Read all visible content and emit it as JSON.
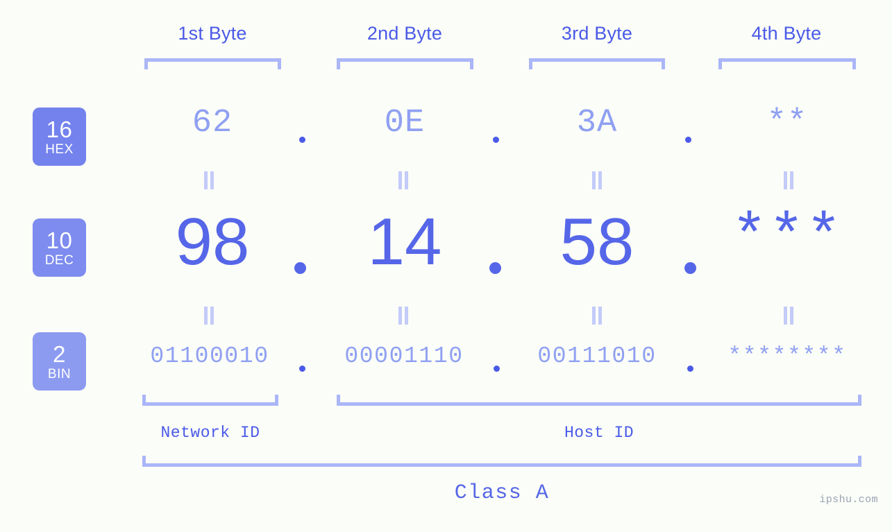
{
  "meta": {
    "background_color": "#FBFDF8",
    "accent_color": "#5566E8",
    "accent_light_color": "#8FA0F2",
    "bracket_color": "#AAB6F7",
    "watermark": "ipshu.com"
  },
  "byte_headers": [
    {
      "label": "1st Byte"
    },
    {
      "label": "2nd Byte"
    },
    {
      "label": "3rd Byte"
    },
    {
      "label": "4th Byte"
    }
  ],
  "bases": [
    {
      "num": "16",
      "name": "HEX",
      "color": "#7382EC"
    },
    {
      "num": "10",
      "name": "DEC",
      "color": "#7D8CEE"
    },
    {
      "num": "2",
      "name": "BIN",
      "color": "#8C9BF0"
    }
  ],
  "rows": {
    "hex": {
      "values": [
        "62",
        "0E",
        "3A",
        "**"
      ],
      "separator": "."
    },
    "dec": {
      "values": [
        "98",
        "14",
        "58",
        "***"
      ],
      "separator": "."
    },
    "bin": {
      "values": [
        "01100010",
        "00001110",
        "00111010",
        "********"
      ],
      "separator": "."
    }
  },
  "id_labels": {
    "network": "Network ID",
    "host": "Host ID"
  },
  "class_label": "Class A",
  "chart_data": {
    "type": "table",
    "title": "Class A",
    "categories": [
      "1st Byte",
      "2nd Byte",
      "3rd Byte",
      "4th Byte"
    ],
    "series": [
      {
        "name": "16 HEX",
        "values": [
          "62",
          "0E",
          "3A",
          "**"
        ]
      },
      {
        "name": "10 DEC",
        "values": [
          "98",
          "14",
          "58",
          "***"
        ]
      },
      {
        "name": "2 BIN",
        "values": [
          "01100010",
          "00001110",
          "00111010",
          "********"
        ]
      }
    ],
    "annotations": {
      "network_id_span": [
        "1st Byte"
      ],
      "host_id_span": [
        "2nd Byte",
        "3rd Byte",
        "4th Byte"
      ],
      "class": "Class A"
    }
  }
}
